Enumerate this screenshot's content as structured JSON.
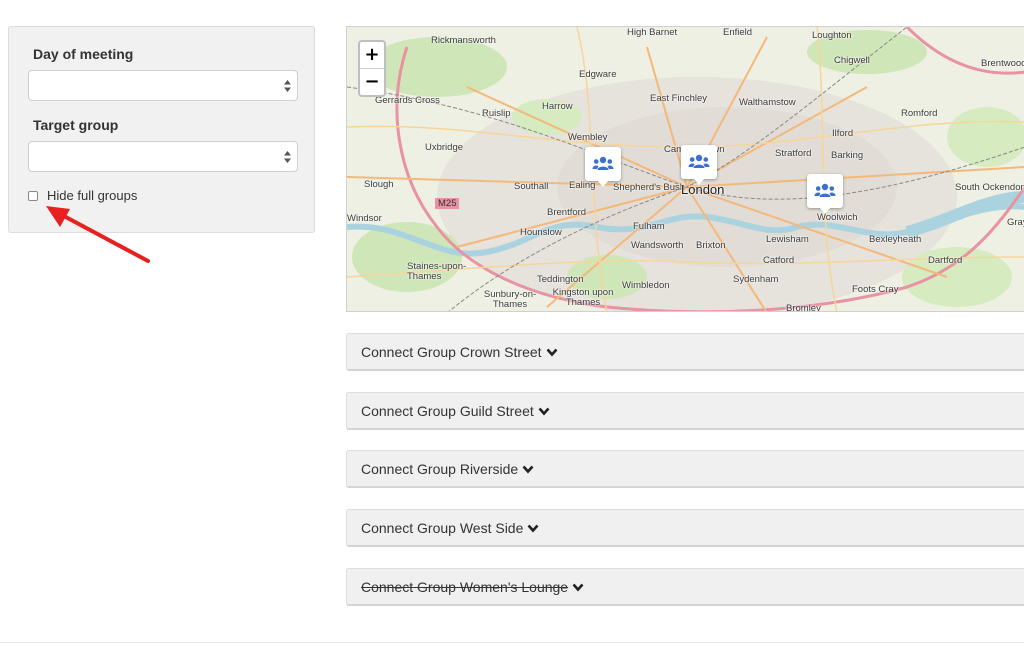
{
  "filters": {
    "day_label": "Day of meeting",
    "day_value": "",
    "group_label": "Target group",
    "group_value": "",
    "hide_full_label": "Hide full groups",
    "hide_full_checked": false
  },
  "map": {
    "zoom_in": "+",
    "zoom_out": "−",
    "places": [
      "Rickmansworth",
      "High Barnet",
      "Enfield",
      "Loughton",
      "Chigwell",
      "Brentwood",
      "Edgware",
      "East Finchley",
      "Walthamstow",
      "Gerrards Cross",
      "Ruislip",
      "Harrow",
      "Romford",
      "Ilford",
      "Wembley",
      "Camden Town",
      "Stratford",
      "Barking",
      "Uxbridge",
      "Slough",
      "Southall",
      "Ealing",
      "Shepherd's Bush",
      "London",
      "South Ockendon",
      "M25",
      "Brentford",
      "Fulham",
      "Woolwich",
      "Windsor",
      "Hounslow",
      "Grays",
      "Lewisham",
      "Bexleyheath",
      "Wandsworth",
      "Brixton",
      "Catford",
      "Dartford",
      "Staines-upon-Thames",
      "Teddington",
      "Sydenham",
      "Wimbledon",
      "Kingston upon Thames",
      "Foots Cray",
      "Sunbury-on-Thames",
      "Bromley"
    ]
  },
  "groups": [
    {
      "title": "Connect Group Crown Street",
      "full": false
    },
    {
      "title": "Connect Group Guild Street",
      "full": false
    },
    {
      "title": "Connect Group Riverside",
      "full": false
    },
    {
      "title": "Connect Group West Side",
      "full": false
    },
    {
      "title": "Connect Group Women's Lounge",
      "full": true
    }
  ],
  "colors": {
    "panel_bg": "#f1f1f1",
    "accordion_bg": "#f0f0f0",
    "marker_icon": "#3b6fd4",
    "annotation_arrow": "#e8201f"
  }
}
